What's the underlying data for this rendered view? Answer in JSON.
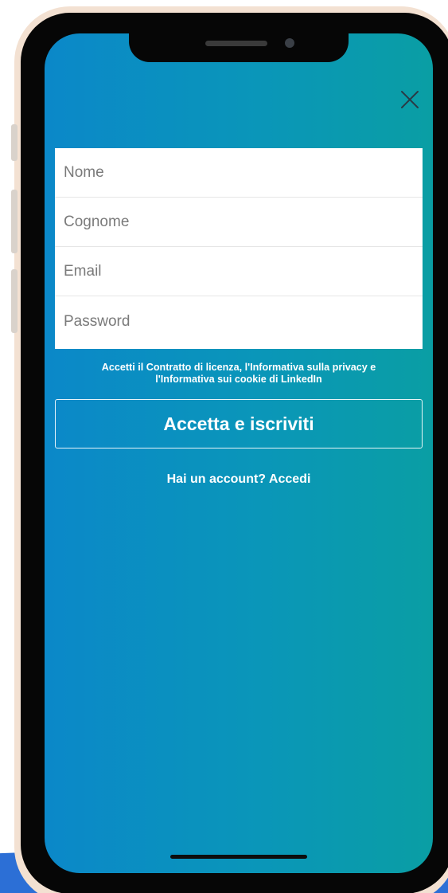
{
  "icons": {
    "close": "close-icon"
  },
  "colors": {
    "screen_gradient_start": "#0b88c9",
    "screen_gradient_end": "#0a9ea4",
    "form_background": "#ffffff",
    "text_on_gradient": "#ffffff"
  },
  "form": {
    "fields": [
      {
        "placeholder": "Nome",
        "value": ""
      },
      {
        "placeholder": "Cognome",
        "value": ""
      },
      {
        "placeholder": "Email",
        "value": ""
      },
      {
        "placeholder": "Password",
        "value": ""
      }
    ]
  },
  "legal": {
    "prefix": "Accetti il ",
    "license_link": "Contratto di licenza",
    "sep1": ", ",
    "privacy_link": "l'Informativa sulla privacy",
    "sep2": " e ",
    "cookie_link": "l'Informativa sui cookie",
    "suffix": " di LinkedIn"
  },
  "actions": {
    "accept_label": "Accetta e iscriviti",
    "has_account_text": "Hai un account?",
    "signin_label": "Accedi"
  }
}
